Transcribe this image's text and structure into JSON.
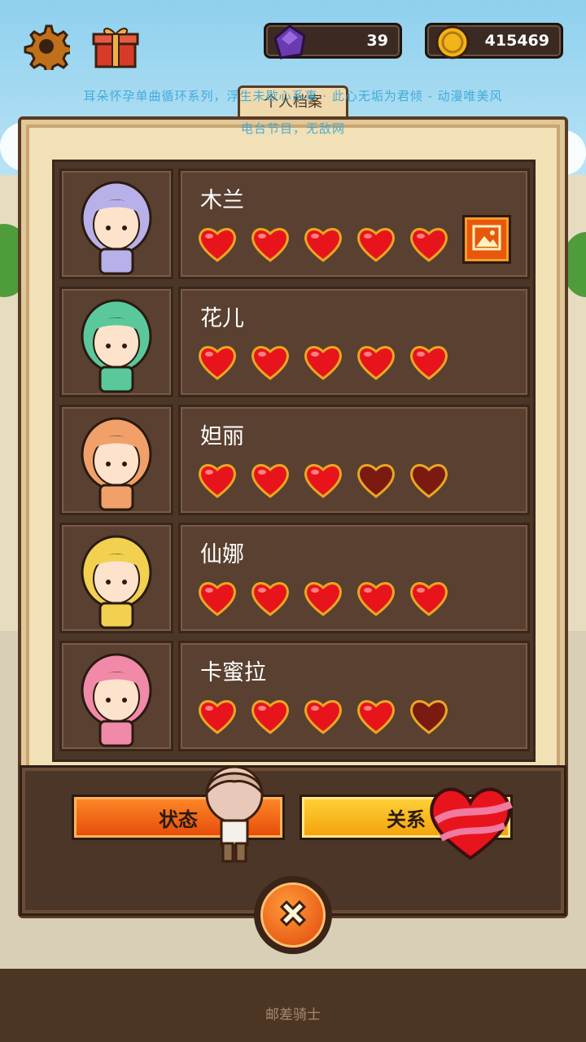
{
  "hud": {
    "gem_count": "39",
    "gold_count": "415469",
    "settings_icon": "gear-icon",
    "gift_icon": "gift-icon"
  },
  "subtitle": {
    "line1": "耳朵怀孕单曲循环系列，浮生未歇心系事 · 此心无垢为君倾 - 动漫唯美风",
    "line2": "电台节目，无敌网"
  },
  "panel": {
    "tab_label": "个人档案"
  },
  "characters": [
    {
      "name": "木兰",
      "hearts_filled": 5,
      "hearts_total": 5,
      "has_album": true
    },
    {
      "name": "花儿",
      "hearts_filled": 5,
      "hearts_total": 5,
      "has_album": false
    },
    {
      "name": "妲丽",
      "hearts_filled": 3,
      "hearts_total": 5,
      "has_album": false
    },
    {
      "name": "仙娜",
      "hearts_filled": 5,
      "hearts_total": 5,
      "has_album": false
    },
    {
      "name": "卡蜜拉",
      "hearts_filled": 4,
      "hearts_total": 5,
      "has_album": false
    }
  ],
  "buttons": {
    "status_label": "状态",
    "relation_label": "关系"
  },
  "footer": {
    "text": "邮差骑士"
  },
  "colors": {
    "heart_full": "#e8141c",
    "heart_empty": "#7a1a10",
    "panel_bg": "#f2e0b6",
    "list_bg": "#4c3627",
    "status_button": "#f26a14",
    "relation_button": "#f8b81a"
  }
}
